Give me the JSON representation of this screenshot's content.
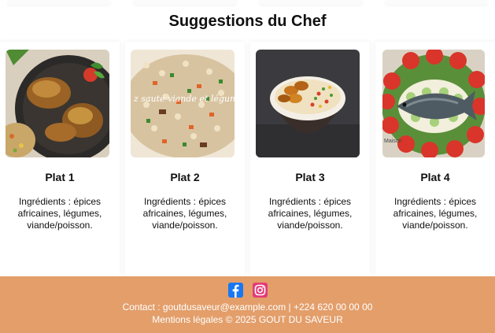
{
  "section": {
    "title": "Suggestions du Chef"
  },
  "dishes": [
    {
      "name": "Plat 1",
      "description": "Ingrédients : épices africaines, légumes, viande/poisson.",
      "image": "grilled-chicken-rice-photo"
    },
    {
      "name": "Plat 2",
      "description": "Ingrédients : épices africaines, légumes, viande/poisson.",
      "image": "fried-rice-vegetables-photo",
      "image_caption": "z sauté viande et légumes"
    },
    {
      "name": "Plat 3",
      "description": "Ingrédients : épices africaines, légumes, viande/poisson.",
      "image": "rice-plantain-bowl-photo"
    },
    {
      "name": "Plat 4",
      "description": "Ingrédients : épices africaines, légumes, viande/poisson.",
      "image": "grilled-fish-platter-photo",
      "image_caption": "Maison"
    }
  ],
  "footer": {
    "social": [
      {
        "icon": "facebook-icon",
        "color": "#1877f2"
      },
      {
        "icon": "instagram-icon",
        "color": "#e23c78"
      }
    ],
    "contact": "Contact : goutdusaveur@example.com | +224 620 00 00 00",
    "legal": "Mentions légales © 2025 GOUT DU SAVEUR",
    "background": "#e39e6a"
  }
}
